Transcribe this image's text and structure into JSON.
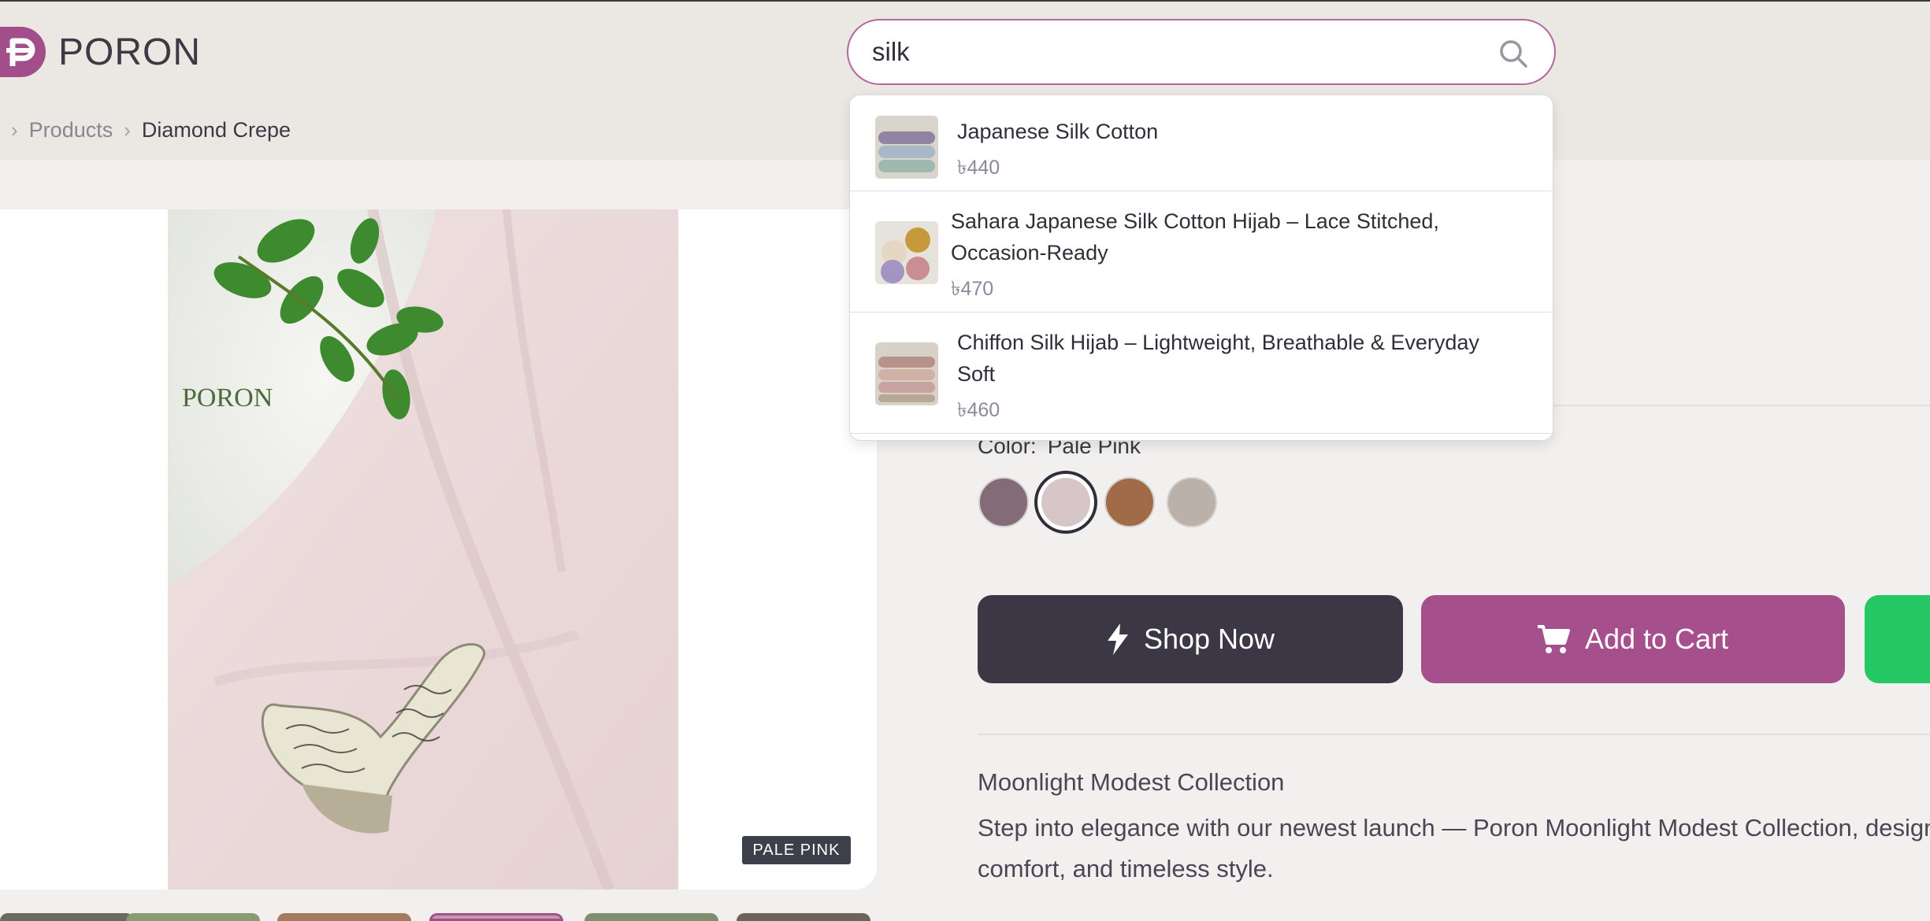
{
  "header": {
    "logo_text": "PORON",
    "search": {
      "value": "silk",
      "placeholder": ""
    }
  },
  "breadcrumb": {
    "items": [
      "Products",
      "Diamond Crepe"
    ]
  },
  "gallery": {
    "watermark": "PORON",
    "color_tag": "PALE PINK"
  },
  "product": {
    "color_label": "Color:",
    "color_value": "Pale Pink",
    "swatches": [
      {
        "name": "mauve",
        "color": "#836c77"
      },
      {
        "name": "pale-pink",
        "color": "#d7c6c7",
        "selected": true
      },
      {
        "name": "brown",
        "color": "#a06b46"
      },
      {
        "name": "stone",
        "color": "#b9b1aa"
      }
    ],
    "shop_now_label": "Shop Now",
    "add_to_cart_label": "Add to Cart",
    "collection_title": "Moonlight Modest Collection",
    "description_line1": "Step into elegance with our newest launch — Poron Moonlight Modest Collection, designe",
    "description_line2": "comfort, and timeless style."
  },
  "search_results": [
    {
      "name": "Japanese Silk Cotton",
      "price": "৳440"
    },
    {
      "name_line1": "Sahara Japanese Silk Cotton Hijab – Lace Stitched,",
      "name_line2": "Occasion-Ready",
      "price": "৳470"
    },
    {
      "name_line1": "Chiffon Silk Hijab – Lightweight, Breathable & Everyday",
      "name_line2": "Soft",
      "price": "৳460"
    }
  ],
  "colors": {
    "brand": "#a54f8d",
    "dark_button": "#3b3744",
    "green_button": "#26c865",
    "search_border": "#b2679f"
  }
}
